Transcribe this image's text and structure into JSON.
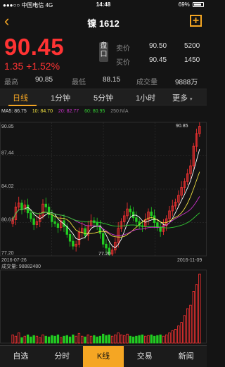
{
  "status_bar": {
    "carrier": "●●●○○ 中国电信 4G",
    "time": "14:48",
    "battery": "69%",
    "battery_level": 0.69
  },
  "header": {
    "back_icon": "chevron-left-icon",
    "title": "镍 1612",
    "add_icon": "plus-box-icon"
  },
  "quote": {
    "price": "90.45",
    "change": "1.35",
    "change_pct": "+1.52%",
    "pankou_label": "盘口",
    "sell_label": "卖价",
    "sell_price": "90.50",
    "sell_vol": "5200",
    "buy_label": "买价",
    "buy_price": "90.45",
    "buy_vol": "1450",
    "high_label": "最高",
    "high": "90.85",
    "low_label": "最低",
    "low": "88.15",
    "volume_label": "成交量",
    "volume": "9888万"
  },
  "tabs": [
    {
      "label": "日线"
    },
    {
      "label": "1分钟"
    },
    {
      "label": "5分钟"
    },
    {
      "label": "1小时"
    },
    {
      "label": "更多"
    }
  ],
  "more_arrow": "▾",
  "ma_legend": {
    "ma5": "MA5: 86.75",
    "ma10": "10: 84.70",
    "ma20": "20: 82.77",
    "ma60": "60: 80.95",
    "ma250": "250:N/A"
  },
  "colors": {
    "up": "#ff3333",
    "down": "#22cc22",
    "accent": "#f5a623",
    "ma5": "#ffffff",
    "ma10": "#f0e040",
    "ma20": "#cc33cc",
    "ma60": "#33cc33",
    "ma250": "#888888"
  },
  "chart_data": {
    "type": "candlestick",
    "y_ticks": [
      "90.85",
      "87.44",
      "84.02",
      "80.61",
      "77.20"
    ],
    "ylim": [
      77.2,
      90.85
    ],
    "max_label": "90.85",
    "min_label": "77.20",
    "start_date": "2016-07-26",
    "end_date": "2016-11-09",
    "volume_label": "成交量: 98882480",
    "closes": [
      80.9,
      82.2,
      82.6,
      82.0,
      82.4,
      81.6,
      81.0,
      80.4,
      80.7,
      81.3,
      82.5,
      82.2,
      81.4,
      80.7,
      80.5,
      80.1,
      80.8,
      80.2,
      79.4,
      78.7,
      78.2,
      78.4,
      79.6,
      80.0,
      79.3,
      80.3,
      80.8,
      80.6,
      80.2,
      79.5,
      78.4,
      78.0,
      77.4,
      77.8,
      78.6,
      80.0,
      80.7,
      81.3,
      82.0,
      81.7,
      81.1,
      80.7,
      80.3,
      80.2,
      80.9,
      81.7,
      81.3,
      80.6,
      80.1,
      79.7,
      80.3,
      81.0,
      81.8,
      82.3,
      82.7,
      83.4,
      84.2,
      84.8,
      85.6,
      86.4,
      88.4,
      89.7,
      90.45
    ],
    "volumes": [
      0.12,
      0.1,
      0.15,
      0.08,
      0.1,
      0.12,
      0.09,
      0.11,
      0.1,
      0.08,
      0.12,
      0.1,
      0.09,
      0.11,
      0.1,
      0.12,
      0.08,
      0.1,
      0.11,
      0.09,
      0.12,
      0.1,
      0.14,
      0.1,
      0.09,
      0.12,
      0.1,
      0.11,
      0.09,
      0.1,
      0.13,
      0.11,
      0.12,
      0.1,
      0.12,
      0.15,
      0.12,
      0.11,
      0.13,
      0.1,
      0.09,
      0.1,
      0.11,
      0.12,
      0.1,
      0.11,
      0.12,
      0.1,
      0.11,
      0.12,
      0.1,
      0.12,
      0.15,
      0.18,
      0.2,
      0.25,
      0.3,
      0.4,
      0.5,
      0.55,
      0.75,
      0.85,
      1.0
    ]
  },
  "bottom_tabs": [
    {
      "label": "自选"
    },
    {
      "label": "分时"
    },
    {
      "label": "K线"
    },
    {
      "label": "交易"
    },
    {
      "label": "新闻"
    }
  ]
}
